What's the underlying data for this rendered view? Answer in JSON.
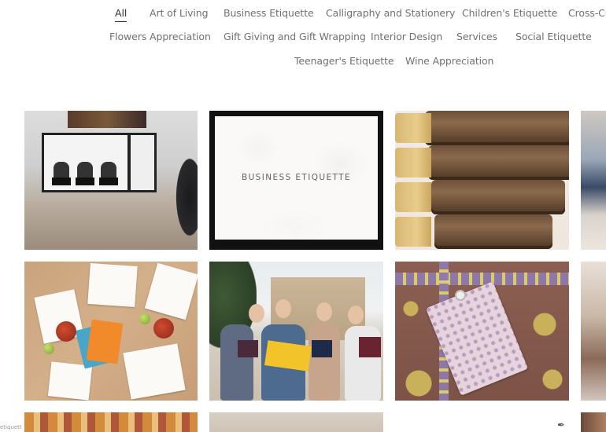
{
  "filters": {
    "items": [
      {
        "label": "All",
        "active": true
      },
      {
        "label": "Art of Living"
      },
      {
        "label": "Business Etiquette"
      },
      {
        "label": "Calligraphy and Stationery"
      },
      {
        "label": "Children's Etiquette"
      },
      {
        "label": "Cross-Cu"
      },
      {
        "label": "Flowers Appreciation"
      },
      {
        "label": "Gift Giving and Gift Wrapping"
      },
      {
        "label": "Interior Design"
      },
      {
        "label": "Services"
      },
      {
        "label": "Social Etiquette"
      },
      {
        "label": "Teenager's Etiquette"
      },
      {
        "label": "Wine Appreciation"
      }
    ]
  },
  "gallery": {
    "business_tile_label": "BUSINESS ETIQUETTE"
  },
  "footer": {
    "corner_text": "etiquett"
  },
  "colors": {
    "text": "#707070",
    "active_text": "#333333",
    "background": "#ffffff"
  }
}
